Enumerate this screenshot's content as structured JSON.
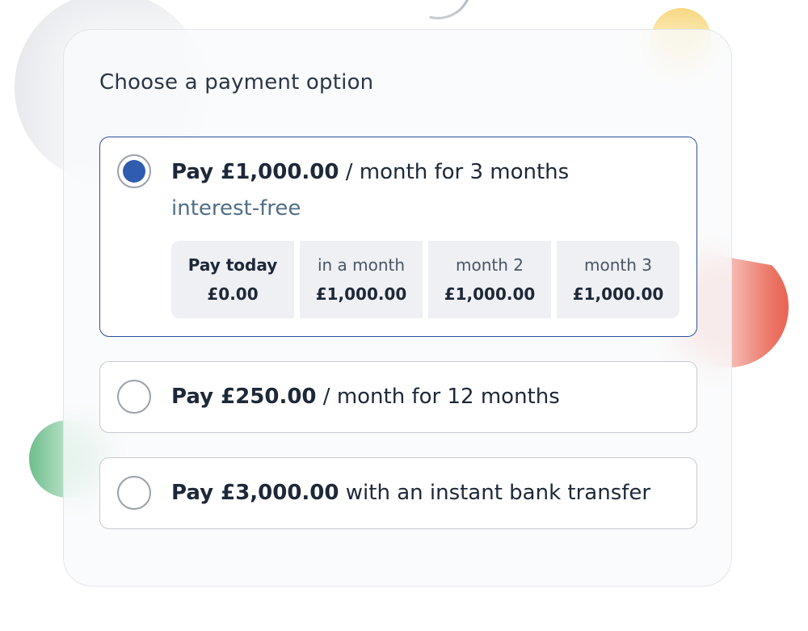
{
  "title": "Choose a payment option",
  "options": [
    {
      "selected": true,
      "amount": "Pay £1,000.00",
      "suffix": " / month for 3 months",
      "note": "interest-free",
      "schedule": [
        {
          "label": "Pay today",
          "amount": "£0.00"
        },
        {
          "label": "in a month",
          "amount": "£1,000.00"
        },
        {
          "label": "month 2",
          "amount": "£1,000.00"
        },
        {
          "label": "month 3",
          "amount": "£1,000.00"
        }
      ]
    },
    {
      "selected": false,
      "amount": "Pay £250.00",
      "suffix": " / month for 12 months"
    },
    {
      "selected": false,
      "amount": "Pay £3,000.00",
      "suffix": " with an instant bank transfer"
    }
  ],
  "colors": {
    "accent": "#2f5cae",
    "selected_border": "#2e4f9b",
    "interest_text": "#4f6f86",
    "schedule_bg": "#eef0f4"
  }
}
